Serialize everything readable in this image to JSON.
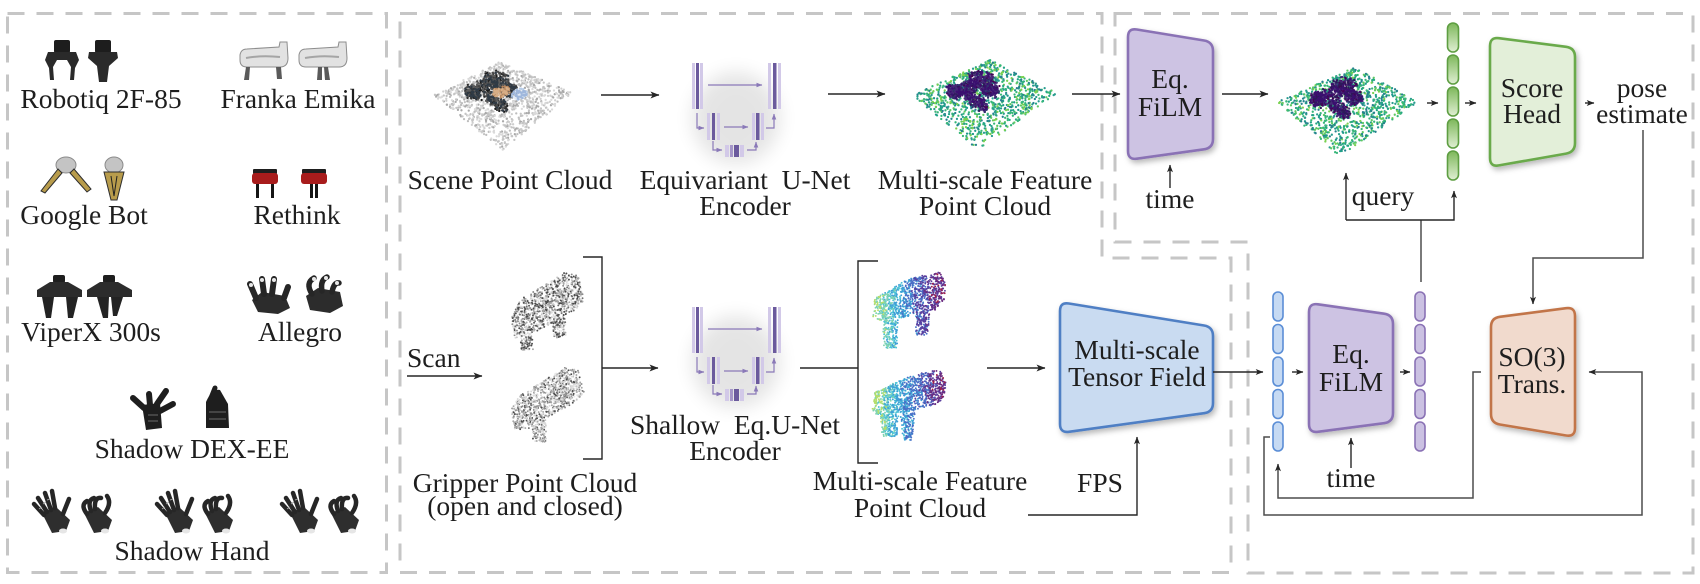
{
  "gripper_library": [
    {
      "label": "Robotiq 2F-85",
      "icons": [
        "robotiq-open-render",
        "robotiq-closed-render"
      ]
    },
    {
      "label": "Franka Emika",
      "icons": [
        "franka-open-render",
        "franka-closed-render"
      ]
    },
    {
      "label": "Google Bot",
      "icons": [
        "google-bot-open-render",
        "google-bot-closed-render"
      ]
    },
    {
      "label": "Rethink",
      "icons": [
        "rethink-open-render",
        "rethink-closed-render"
      ]
    },
    {
      "label": "ViperX 300s",
      "icons": [
        "viperx-open-render",
        "viperx-closed-render"
      ]
    },
    {
      "label": "Allegro",
      "icons": [
        "allegro-open-render",
        "allegro-closed-render"
      ]
    },
    {
      "label": "Shadow DEX-EE",
      "icons": [
        "dex-ee-open-render",
        "dex-ee-closed-render"
      ]
    },
    {
      "label": "Shadow Hand",
      "icons": [
        "shadow-hand-open-render",
        "shadow-hand-closed-render"
      ]
    }
  ],
  "scene_branch": {
    "input_label": "Scene Point Cloud",
    "encoder_label": [
      "Equivariant  U-Net",
      "Encoder"
    ],
    "feature_label": [
      "Multi-scale Feature",
      "Point Cloud"
    ]
  },
  "gripper_branch": {
    "scan_label": "Scan",
    "input_label": [
      "Gripper Point Cloud",
      "(open and closed)"
    ],
    "encoder_label": [
      "Shallow  Eq.U-Net",
      "Encoder"
    ],
    "feature_label": [
      "Multi-scale Feature",
      "Point Cloud"
    ],
    "tensor_field_label": [
      "Multi-scale",
      "Tensor Field"
    ],
    "fps_label": "FPS"
  },
  "denoiser": {
    "film_top_label": [
      "Eq.",
      "FiLM"
    ],
    "film_top_time": "time",
    "query_label": "query",
    "score_head_label": [
      "Score",
      "Head"
    ],
    "output_label": [
      "pose",
      "estimate"
    ],
    "film_bottom_label": [
      "Eq.",
      "FiLM"
    ],
    "film_bottom_time": "time",
    "so3_label": [
      "SO(3)",
      "Trans."
    ]
  },
  "colors": {
    "dashed_frame": "#c6c6c6",
    "film": {
      "fill": "#cdc3e3",
      "stroke": "#8a72b5"
    },
    "score_head": {
      "fill": "#e3efd9",
      "stroke": "#6aaa4b"
    },
    "tensor_field": {
      "fill": "#c9dbf1",
      "stroke": "#4f7fc4"
    },
    "so3": {
      "fill": "#f1dacd",
      "stroke": "#c27548"
    },
    "query_tokens": {
      "top": "#7db75a",
      "bottom": "#e0efd3",
      "stroke": "#5e9e42"
    },
    "gripper_tokens": {
      "fill": "#c6daf3",
      "stroke": "#5b8ed6"
    },
    "film_tokens": {
      "fill": "#cbc1e2",
      "stroke": "#8a72b5"
    }
  }
}
